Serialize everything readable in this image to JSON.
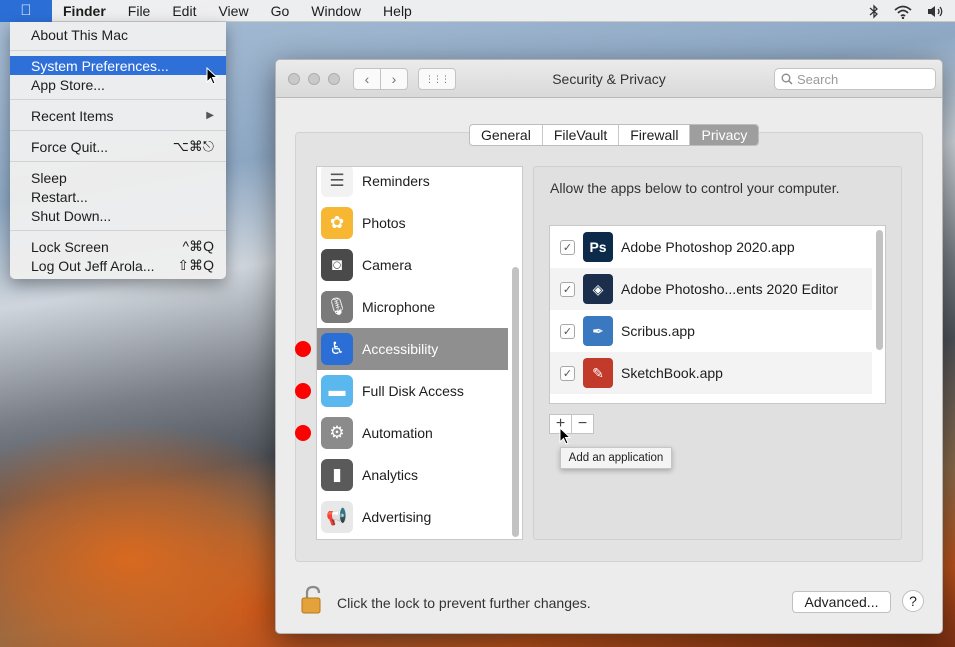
{
  "menubar": {
    "apple_icon": "",
    "items": [
      "Finder",
      "File",
      "Edit",
      "View",
      "Go",
      "Window",
      "Help"
    ],
    "status_icons": [
      "bluetooth-icon",
      "wifi-icon",
      "volume-icon"
    ]
  },
  "apple_menu": {
    "about": "About This Mac",
    "system_prefs": "System Preferences...",
    "app_store": "App Store...",
    "recent_items": "Recent Items",
    "recent_arrow": "▶",
    "force_quit": "Force Quit...",
    "force_quit_shortcut": "⌥⌘⎋",
    "sleep": "Sleep",
    "restart": "Restart...",
    "shutdown": "Shut Down...",
    "lock_screen": "Lock Screen",
    "lock_shortcut": "^⌘Q",
    "logout": "Log Out Jeff Arola...",
    "logout_shortcut": "⇧⌘Q"
  },
  "window": {
    "title": "Security & Privacy",
    "back": "‹",
    "forward": "›",
    "grid": "⋮⋮⋮",
    "search_placeholder": "Search",
    "tabs": [
      {
        "label": "General",
        "active": false
      },
      {
        "label": "FileVault",
        "active": false
      },
      {
        "label": "Firewall",
        "active": false
      },
      {
        "label": "Privacy",
        "active": true
      }
    ]
  },
  "categories": [
    {
      "label": "Reminders",
      "icon": "reminders-icon",
      "glyph": "☰",
      "color": "#f2f2f2",
      "selected": false,
      "marked": false
    },
    {
      "label": "Photos",
      "icon": "photos-icon",
      "glyph": "✿",
      "color": "#f7b733",
      "selected": false,
      "marked": false
    },
    {
      "label": "Camera",
      "icon": "camera-icon",
      "glyph": "◙",
      "color": "#4a4a4a",
      "selected": false,
      "marked": false
    },
    {
      "label": "Microphone",
      "icon": "microphone-icon",
      "glyph": "🎙",
      "color": "#7a7a7a",
      "selected": false,
      "marked": false
    },
    {
      "label": "Accessibility",
      "icon": "accessibility-icon",
      "glyph": "♿",
      "color": "#2b6fd6",
      "selected": true,
      "marked": true
    },
    {
      "label": "Full Disk Access",
      "icon": "folder-icon",
      "glyph": "▬",
      "color": "#5bb8ee",
      "selected": false,
      "marked": true
    },
    {
      "label": "Automation",
      "icon": "gear-icon",
      "glyph": "⚙",
      "color": "#8b8b8b",
      "selected": false,
      "marked": true
    },
    {
      "label": "Analytics",
      "icon": "analytics-icon",
      "glyph": "▮",
      "color": "#5a5a5a",
      "selected": false,
      "marked": false
    },
    {
      "label": "Advertising",
      "icon": "megaphone-icon",
      "glyph": "📢",
      "color": "#e8e8e8",
      "selected": false,
      "marked": false
    }
  ],
  "privacy": {
    "description": "Allow the apps below to control your computer.",
    "apps": [
      {
        "name": "Adobe Photoshop 2020.app",
        "icon": "photoshop-icon",
        "glyph": "Ps",
        "color": "#0c2a4a",
        "checked": true
      },
      {
        "name": "Adobe Photosho...ents 2020 Editor",
        "icon": "photoshop-elements-icon",
        "glyph": "◈",
        "color": "#1b2f4d",
        "checked": true
      },
      {
        "name": "Scribus.app",
        "icon": "scribus-icon",
        "glyph": "✒",
        "color": "#3a79c0",
        "checked": true
      },
      {
        "name": "SketchBook.app",
        "icon": "sketchbook-icon",
        "glyph": "✎",
        "color": "#c23a2a",
        "checked": true
      }
    ],
    "add_label": "+",
    "remove_label": "−",
    "tooltip": "Add an application"
  },
  "footer": {
    "lock_text": "Click the lock to prevent further changes.",
    "advanced": "Advanced...",
    "help": "?"
  }
}
